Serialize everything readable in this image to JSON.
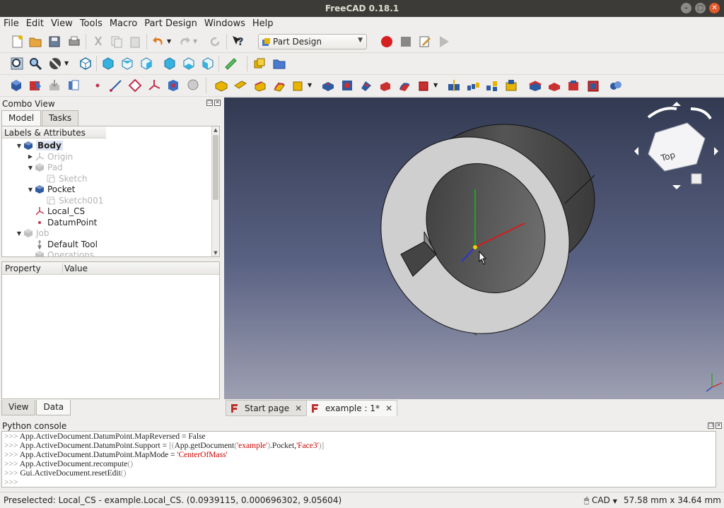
{
  "window": {
    "title": "FreeCAD 0.18.1"
  },
  "menu": [
    "File",
    "Edit",
    "View",
    "Tools",
    "Macro",
    "Part Design",
    "Windows",
    "Help"
  ],
  "toolbar": {
    "workbench": "Part Design"
  },
  "combo_view": {
    "title": "Combo View",
    "tabs": [
      "Model",
      "Tasks"
    ],
    "tree_header": "Labels & Attributes",
    "tree": [
      {
        "label": "Body",
        "indent": 0,
        "expanded": true,
        "selected": true,
        "dim": false,
        "icon": "body-icon"
      },
      {
        "label": "Origin",
        "indent": 1,
        "expanded": false,
        "dim": true,
        "icon": "origin-icon"
      },
      {
        "label": "Pad",
        "indent": 1,
        "expanded": true,
        "dim": true,
        "icon": "pad-icon"
      },
      {
        "label": "Sketch",
        "indent": 2,
        "dim": true,
        "icon": "sketch-icon"
      },
      {
        "label": "Pocket",
        "indent": 1,
        "expanded": true,
        "dim": false,
        "icon": "pocket-icon"
      },
      {
        "label": "Sketch001",
        "indent": 2,
        "dim": true,
        "icon": "sketch-icon"
      },
      {
        "label": "Local_CS",
        "indent": 1,
        "dim": false,
        "icon": "local-cs-icon"
      },
      {
        "label": "DatumPoint",
        "indent": 1,
        "dim": false,
        "icon": "datum-point-icon"
      },
      {
        "label": "Job",
        "indent": 0,
        "expanded": true,
        "dim": true,
        "icon": "job-icon"
      },
      {
        "label": "Default Tool",
        "indent": 1,
        "dim": false,
        "icon": "tool-icon"
      },
      {
        "label": "Operations",
        "indent": 1,
        "dim": true,
        "icon": "operations-icon"
      }
    ],
    "property_header": {
      "property": "Property",
      "value": "Value"
    },
    "bottom_tabs": [
      "View",
      "Data"
    ]
  },
  "document_tabs": [
    {
      "label": "Start page",
      "active": false
    },
    {
      "label": "example : 1*",
      "active": true
    }
  ],
  "nav_cube": {
    "face": "Top"
  },
  "python_console": {
    "title": "Python console",
    "lines": [
      [
        [
          "p",
          ">>> "
        ],
        [
          "t",
          "App.ActiveDocument.DatumPoint.MapReversed = False"
        ]
      ],
      [
        [
          "p",
          ">>> "
        ],
        [
          "t",
          "App.ActiveDocument.DatumPoint.Support = "
        ],
        [
          "g",
          "[("
        ],
        [
          "t",
          "App.getDocument"
        ],
        [
          "g",
          "("
        ],
        [
          "s",
          "'example'"
        ],
        [
          "g",
          ")"
        ],
        [
          "t",
          ".Pocket,"
        ],
        [
          "s",
          "'Face3'"
        ],
        [
          "g",
          ")]"
        ]
      ],
      [
        [
          "p",
          ">>> "
        ],
        [
          "t",
          "App.ActiveDocument.DatumPoint.MapMode = "
        ],
        [
          "s",
          "'CenterOfMass'"
        ]
      ],
      [
        [
          "p",
          ">>> "
        ],
        [
          "t",
          "App.ActiveDocument.recompute"
        ],
        [
          "g",
          "()"
        ]
      ],
      [
        [
          "p",
          ">>> "
        ],
        [
          "t",
          "Gui.ActiveDocument.resetEdit"
        ],
        [
          "g",
          "()"
        ]
      ],
      [
        [
          "p",
          ">>> "
        ]
      ]
    ]
  },
  "status": {
    "message": "Preselected: Local_CS - example.Local_CS. (0.0939115, 0.000696302, 9.05604)",
    "navigation": "CAD",
    "dimensions": "57.58 mm x 34.64 mm"
  },
  "colors": {
    "viewport_top": "#323a52",
    "viewport_bottom": "#9ea0b2",
    "selection": "#dde4f2"
  }
}
